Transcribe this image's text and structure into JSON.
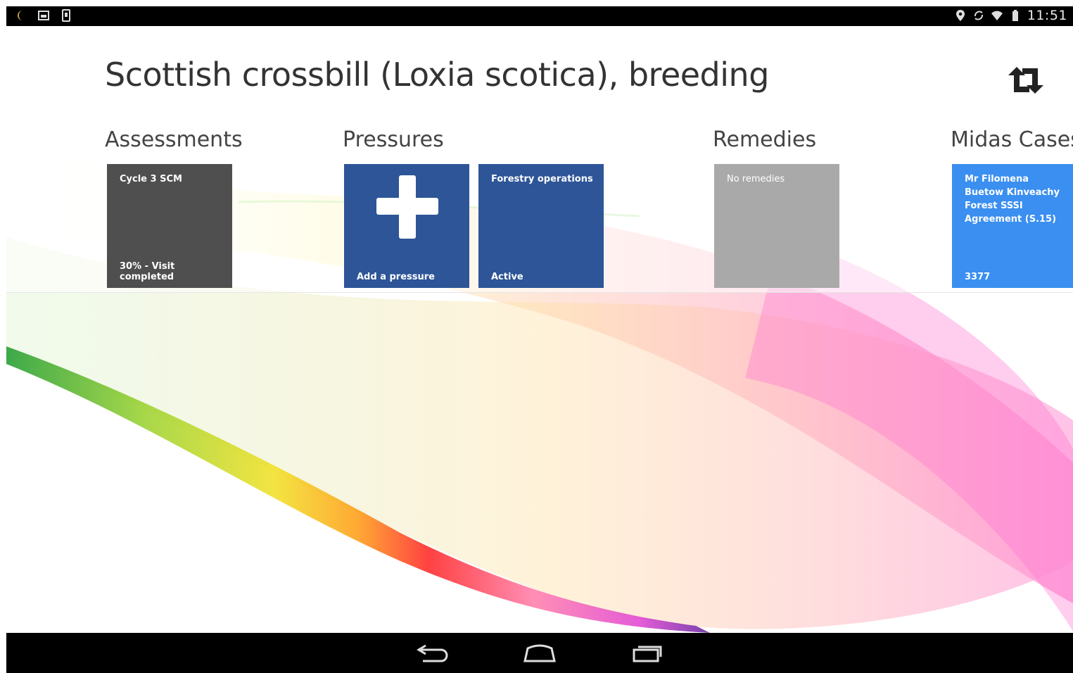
{
  "status_bar": {
    "time": "11:51",
    "left_icons": [
      "moon-icon",
      "image-icon",
      "phone-icon"
    ],
    "right_icons": [
      "location-icon",
      "sync-icon",
      "wifi-icon",
      "battery-icon"
    ]
  },
  "header": {
    "title": "Scottish crossbill (Loxia scotica), breeding",
    "action_icon": "sync-arrows-icon"
  },
  "sections": {
    "assessments": {
      "heading": "Assessments",
      "tiles": [
        {
          "top": "Cycle 3 SCM",
          "bottom": "30% - Visit completed"
        }
      ]
    },
    "pressures": {
      "heading": "Pressures",
      "tiles": [
        {
          "top": "",
          "bottom": "Add a pressure",
          "icon": "plus-icon"
        },
        {
          "top": "Forestry operations",
          "bottom": "Active"
        }
      ]
    },
    "remedies": {
      "heading": "Remedies",
      "tiles": [
        {
          "top": "No remedies",
          "bottom": ""
        }
      ]
    },
    "midas": {
      "heading": "Midas Cases",
      "tiles": [
        {
          "top": "Mr Filomena Buetow Kinveachy Forest SSSI Agreement (S.15)",
          "bottom": "3377"
        }
      ]
    }
  },
  "nav_bar": {
    "buttons": [
      "back-icon",
      "home-icon",
      "recent-apps-icon"
    ]
  },
  "colors": {
    "assessment_tile": "#4f4f4f",
    "pressure_tile": "#2d5597",
    "remedy_tile": "#a9a9a9",
    "midas_tile": "#3a8ff0"
  }
}
